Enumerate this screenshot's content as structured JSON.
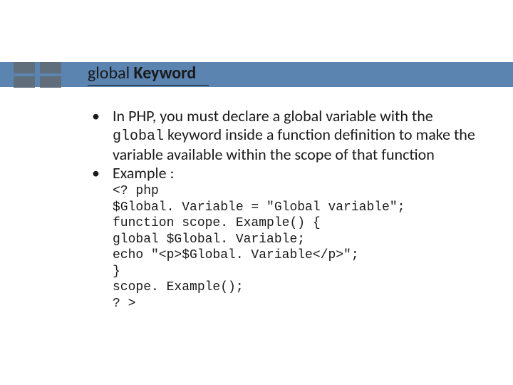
{
  "title": {
    "word1": "global",
    "word2": " Keyword"
  },
  "bullets": {
    "item1": {
      "pre": "In PHP, you must declare a global variable with the ",
      "code": "global",
      "post": " keyword inside a function definition to make the variable available within the scope of that function"
    },
    "item2": "Example :"
  },
  "code": {
    "l1": "<? php",
    "l2": "$Global. Variable = \"Global variable\";",
    "l3": "function scope. Example() {",
    "l4": "global $Global. Variable;",
    "l5": "echo \"<p>$Global. Variable</p>\";",
    "l6": "}",
    "l7": "scope. Example();",
    "l8": "? >"
  }
}
